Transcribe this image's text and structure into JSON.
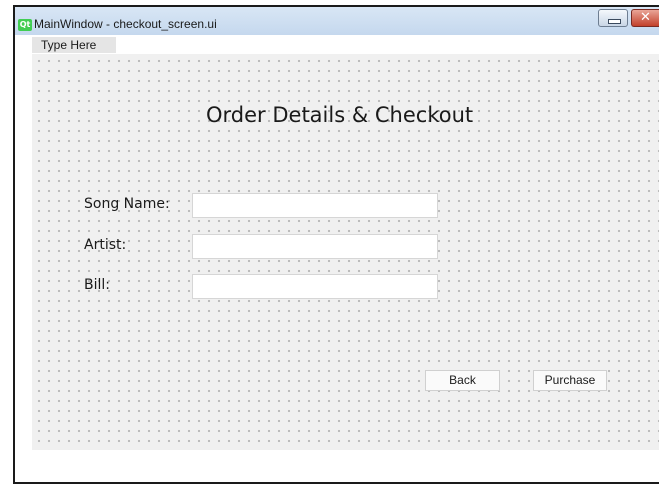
{
  "window": {
    "logo_text": "Qt",
    "title": "MainWindow - checkout_screen.ui",
    "close_glyph": "✕"
  },
  "menubar": {
    "items": [
      {
        "label": "Type Here"
      }
    ]
  },
  "form": {
    "heading": "Order Details & Checkout",
    "fields": [
      {
        "label": "Song Name:",
        "value": ""
      },
      {
        "label": "Artist:",
        "value": ""
      },
      {
        "label": "Bill:",
        "value": ""
      }
    ]
  },
  "buttons": {
    "back": "Back",
    "purchase": "Purchase"
  }
}
